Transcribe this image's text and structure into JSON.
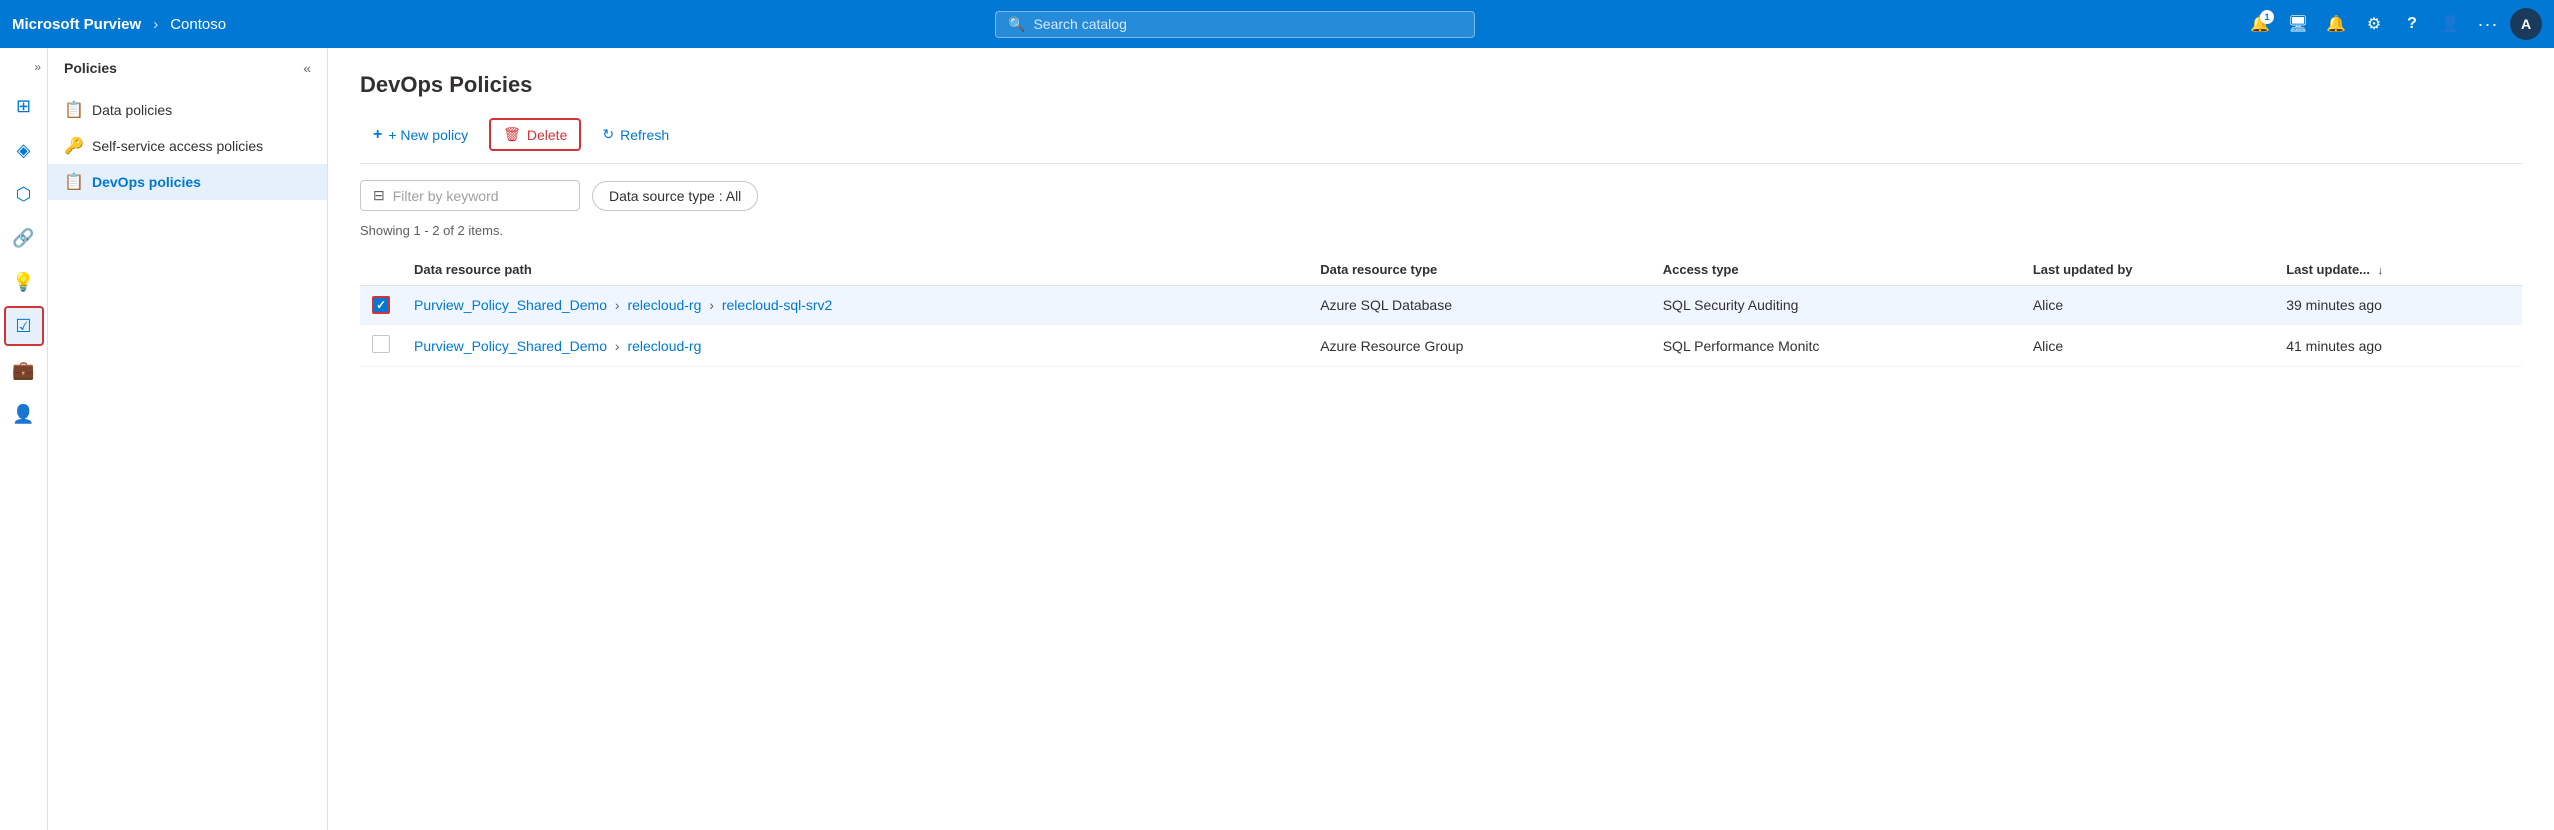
{
  "topnav": {
    "brand": "Microsoft Purview",
    "sep": "›",
    "tenant": "Contoso",
    "search_placeholder": "Search catalog",
    "notification_count": "1",
    "avatar_label": "A"
  },
  "sidebar": {
    "collapse_label": "«",
    "expand_label": "»",
    "section_title": "Policies",
    "items": [
      {
        "label": "Data policies",
        "icon": "📋"
      },
      {
        "label": "Self-service access policies",
        "icon": "🔑"
      },
      {
        "label": "DevOps policies",
        "icon": "📋",
        "active": true
      }
    ]
  },
  "main": {
    "page_title": "DevOps Policies",
    "toolbar": {
      "new_policy": "+ New policy",
      "delete": "Delete",
      "refresh": "Refresh"
    },
    "filter": {
      "placeholder": "Filter by keyword",
      "datasource_label": "Data source type : All"
    },
    "showing_text": "Showing 1 - 2 of 2 items.",
    "table": {
      "columns": [
        {
          "label": "Data resource path"
        },
        {
          "label": "Data resource type"
        },
        {
          "label": "Access type"
        },
        {
          "label": "Last updated by"
        },
        {
          "label": "Last update...",
          "sorted": true
        }
      ],
      "rows": [
        {
          "checked": true,
          "path": "Purview_Policy_Shared_Demo > relecloud-rg > relecloud-sql-srv2",
          "resource_type": "Azure SQL Database",
          "access_type": "SQL Security Auditing",
          "updated_by": "Alice",
          "last_update": "39 minutes ago"
        },
        {
          "checked": false,
          "path": "Purview_Policy_Shared_Demo > relecloud-rg",
          "resource_type": "Azure Resource Group",
          "access_type": "SQL Performance Monitc",
          "updated_by": "Alice",
          "last_update": "41 minutes ago"
        }
      ]
    }
  },
  "icons": {
    "search": "🔍",
    "notification": "🔔",
    "monitor": "🖥",
    "settings": "⚙",
    "help": "?",
    "person": "👤",
    "more": "···",
    "filter": "⊟",
    "refresh": "↻",
    "delete": "🗑",
    "plus": "+",
    "sort_desc": "↓"
  }
}
